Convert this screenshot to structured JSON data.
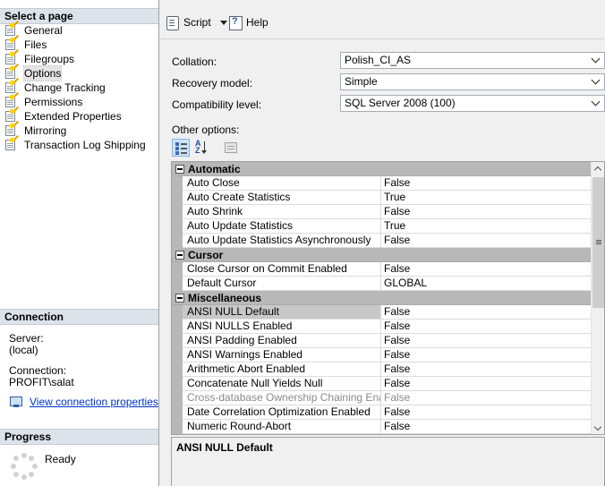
{
  "left_pane": {
    "select_page_header": "Select a page",
    "pages": [
      {
        "label": "General",
        "selected": false
      },
      {
        "label": "Files",
        "selected": false
      },
      {
        "label": "Filegroups",
        "selected": false
      },
      {
        "label": "Options",
        "selected": true
      },
      {
        "label": "Change Tracking",
        "selected": false
      },
      {
        "label": "Permissions",
        "selected": false
      },
      {
        "label": "Extended Properties",
        "selected": false
      },
      {
        "label": "Mirroring",
        "selected": false
      },
      {
        "label": "Transaction Log Shipping",
        "selected": false
      }
    ],
    "connection_header": "Connection",
    "server_label": "Server:",
    "server_value": "(local)",
    "connection_label": "Connection:",
    "connection_value": "PROFIT\\salat",
    "view_connection_link": "View connection properties",
    "progress_header": "Progress",
    "progress_status": "Ready"
  },
  "toolbar": {
    "script_label": "Script",
    "help_label": "Help"
  },
  "fields": {
    "collation_label": "Collation:",
    "collation_value": "Polish_CI_AS",
    "recovery_label": "Recovery model:",
    "recovery_value": "Simple",
    "compat_label": "Compatibility level:",
    "compat_value": "SQL Server 2008 (100)",
    "other_options_label": "Other options:"
  },
  "grid": {
    "categories": [
      {
        "name": "Automatic",
        "rows": [
          {
            "name": "Auto Close",
            "value": "False"
          },
          {
            "name": "Auto Create Statistics",
            "value": "True"
          },
          {
            "name": "Auto Shrink",
            "value": "False"
          },
          {
            "name": "Auto Update Statistics",
            "value": "True"
          },
          {
            "name": "Auto Update Statistics Asynchronously",
            "value": "False"
          }
        ]
      },
      {
        "name": "Cursor",
        "rows": [
          {
            "name": "Close Cursor on Commit Enabled",
            "value": "False"
          },
          {
            "name": "Default Cursor",
            "value": "GLOBAL"
          }
        ]
      },
      {
        "name": "Miscellaneous",
        "rows": [
          {
            "name": "ANSI NULL Default",
            "value": "False",
            "selected": true
          },
          {
            "name": "ANSI NULLS Enabled",
            "value": "False"
          },
          {
            "name": "ANSI Padding Enabled",
            "value": "False"
          },
          {
            "name": "ANSI Warnings Enabled",
            "value": "False"
          },
          {
            "name": "Arithmetic Abort Enabled",
            "value": "False"
          },
          {
            "name": "Concatenate Null Yields Null",
            "value": "False"
          },
          {
            "name": "Cross-database Ownership Chaining Enabled",
            "value": "False",
            "disabled": true
          },
          {
            "name": "Date Correlation Optimization Enabled",
            "value": "False"
          },
          {
            "name": "Numeric Round-Abort",
            "value": "False"
          }
        ]
      }
    ]
  },
  "description": {
    "title": "ANSI NULL Default"
  }
}
